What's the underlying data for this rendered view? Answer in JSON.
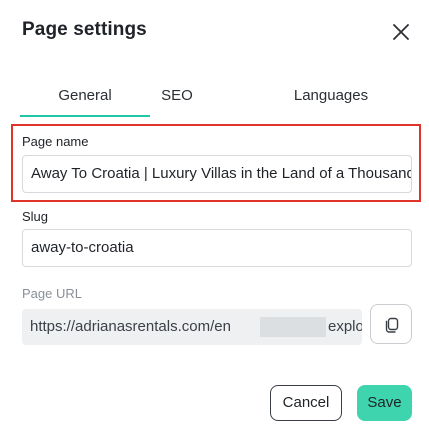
{
  "dialog": {
    "title": "Page settings"
  },
  "tabs": [
    {
      "label": "General",
      "active": true
    },
    {
      "label": "SEO",
      "active": false
    },
    {
      "label": "Languages",
      "active": false
    }
  ],
  "fields": {
    "page_name": {
      "label": "Page name",
      "value": "Away To Croatia | Luxury Villas in the Land of a Thousand"
    },
    "slug": {
      "label": "Slug",
      "value": "away-to-croatia"
    },
    "page_url": {
      "label": "Page URL",
      "value_prefix": "https://adrianasrentals.com/en",
      "value_suffix": "explore"
    }
  },
  "icons": {
    "close": "close-icon",
    "copy": "copy-icon"
  },
  "buttons": {
    "cancel_label": "Cancel",
    "save_label": "Save"
  },
  "colors": {
    "accent": "#21c7a8",
    "save_bg": "#3ed4ae",
    "highlight": "#e0342a"
  }
}
